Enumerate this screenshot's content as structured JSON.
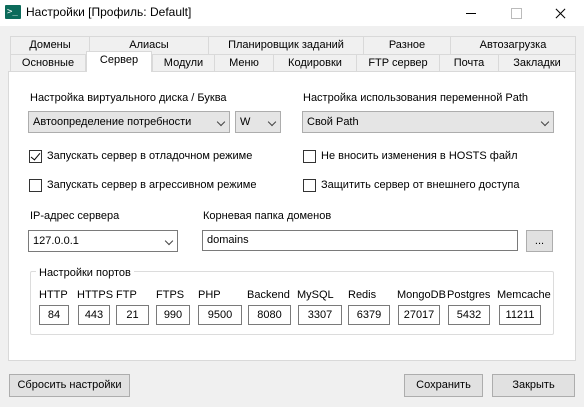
{
  "window": {
    "title": "Настройки [Профиль: Default]",
    "minimize": "–",
    "maximize": "□",
    "close": "✕"
  },
  "tabs": {
    "row_top": [
      "Домены",
      "Алиасы",
      "Планировщик заданий",
      "Разное",
      "Автозагрузка"
    ],
    "row_bottom": [
      "Основные",
      "Сервер",
      "Модули",
      "Меню",
      "Кодировки",
      "FTP сервер",
      "Почта",
      "Закладки"
    ],
    "active": "Сервер"
  },
  "server": {
    "virtual_disk_label": "Настройка виртуального диска / Буква",
    "virtual_disk_value": "Автоопределение потребности",
    "disk_letter": "W",
    "path_label": "Настройка использования переменной Path",
    "path_value": "Свой Path",
    "debug_mode": {
      "label": "Запускать сервер в отладочном режиме",
      "checked": true
    },
    "aggressive_mode": {
      "label": "Запускать сервер в агрессивном режиме",
      "checked": false
    },
    "no_hosts": {
      "label": "Не вносить изменения в HOSTS файл",
      "checked": false
    },
    "protect": {
      "label": "Защитить сервер от внешнего доступа",
      "checked": false
    },
    "ip_label": "IP-адрес сервера",
    "ip_value": "127.0.0.1",
    "domains_root_label": "Корневая папка доменов",
    "domains_root_value": "domains",
    "browse_label": "...",
    "ports_title": "Настройки портов",
    "ports": [
      {
        "name": "HTTP",
        "value": "84"
      },
      {
        "name": "HTTPS",
        "value": "443"
      },
      {
        "name": "FTP",
        "value": "21"
      },
      {
        "name": "FTPS",
        "value": "990"
      },
      {
        "name": "PHP",
        "value": "9500"
      },
      {
        "name": "Backend",
        "value": "8080"
      },
      {
        "name": "MySQL",
        "value": "3307"
      },
      {
        "name": "Redis",
        "value": "6379"
      },
      {
        "name": "MongoDB",
        "value": "27017"
      },
      {
        "name": "Postgres",
        "value": "5432"
      },
      {
        "name": "Memcache",
        "value": "11211"
      }
    ]
  },
  "footer": {
    "reset_label": "Сбросить настройки",
    "save_label": "Сохранить",
    "close_label": "Закрыть"
  }
}
